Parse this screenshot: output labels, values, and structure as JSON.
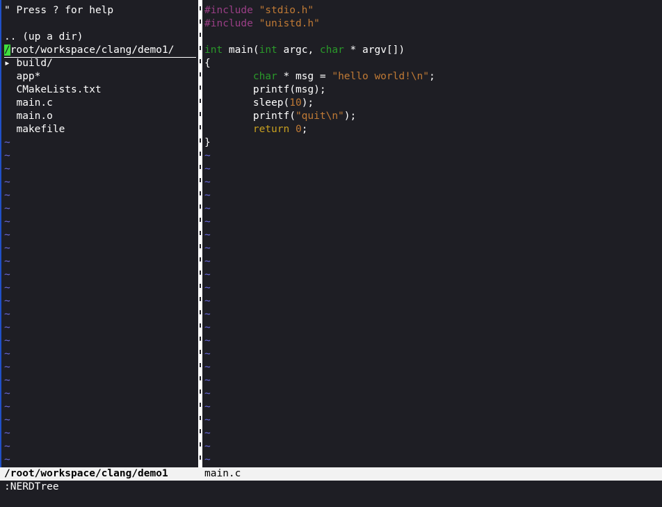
{
  "nerdtree": {
    "help_hint": "\" Press ? for help",
    "up_dir": ".. (up a dir)",
    "cwd_cursor": "/",
    "cwd_rest": "root/workspace/clang/demo1/",
    "entries": [
      {
        "marker": "▸ ",
        "name": "build/"
      },
      {
        "marker": "  ",
        "name": "app*"
      },
      {
        "marker": "  ",
        "name": "CMakeLists.txt"
      },
      {
        "marker": "  ",
        "name": "main.c"
      },
      {
        "marker": "  ",
        "name": "main.o"
      },
      {
        "marker": "  ",
        "name": "makefile"
      }
    ]
  },
  "editor": {
    "lines": [
      [
        {
          "t": "#include ",
          "c": "pre"
        },
        {
          "t": "\"stdio.h\"",
          "c": "str"
        }
      ],
      [
        {
          "t": "#include ",
          "c": "pre"
        },
        {
          "t": "\"unistd.h\"",
          "c": "str"
        }
      ],
      [],
      [
        {
          "t": "int",
          "c": "type"
        },
        {
          "t": " main(",
          "c": "txt"
        },
        {
          "t": "int",
          "c": "type"
        },
        {
          "t": " argc, ",
          "c": "txt"
        },
        {
          "t": "char",
          "c": "type"
        },
        {
          "t": " * argv[])",
          "c": "txt"
        }
      ],
      [
        {
          "t": "{",
          "c": "txt"
        }
      ],
      [
        {
          "t": "        ",
          "c": "txt"
        },
        {
          "t": "char",
          "c": "type"
        },
        {
          "t": " * msg = ",
          "c": "txt"
        },
        {
          "t": "\"hello world!\\n\"",
          "c": "str"
        },
        {
          "t": ";",
          "c": "txt"
        }
      ],
      [
        {
          "t": "        printf(msg);",
          "c": "txt"
        }
      ],
      [
        {
          "t": "        sleep(",
          "c": "txt"
        },
        {
          "t": "10",
          "c": "num"
        },
        {
          "t": ");",
          "c": "txt"
        }
      ],
      [
        {
          "t": "        printf(",
          "c": "txt"
        },
        {
          "t": "\"quit\\n\"",
          "c": "str"
        },
        {
          "t": ");",
          "c": "txt"
        }
      ],
      [
        {
          "t": "        ",
          "c": "txt"
        },
        {
          "t": "return",
          "c": "kw"
        },
        {
          "t": " ",
          "c": "txt"
        },
        {
          "t": "0",
          "c": "num"
        },
        {
          "t": ";",
          "c": "txt"
        }
      ],
      [
        {
          "t": "}",
          "c": "txt"
        }
      ]
    ],
    "tilde_char": "~"
  },
  "statusline": {
    "left": "/root/workspace/clang/demo1",
    "right": "main.c"
  },
  "cmdline": ":NERDTree",
  "colors": {
    "background": "#1e1e24",
    "tilde": "#6a6adc",
    "preproc": "#9a3f86",
    "string": "#c07a35",
    "type": "#2a9a2a",
    "keyword": "#c8a020",
    "cursor": "#3ee03e",
    "statusline_bg": "#f2f2f2"
  }
}
